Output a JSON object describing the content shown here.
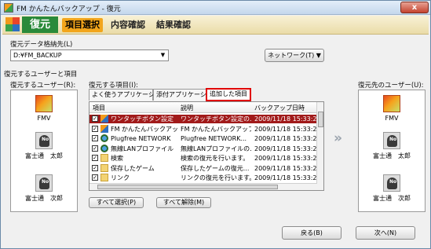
{
  "window": {
    "title": "FM かんたんバックアップ - 復元",
    "close_label": "x"
  },
  "header": {
    "mode": "復元",
    "steps": [
      "項目選択",
      "内容確認",
      "結果確認"
    ],
    "active_step": 0
  },
  "destination": {
    "label": "復元データ格納先(L)",
    "value": "D:¥FM_BACKUP",
    "network_button": "ネットワーク(T) ▼"
  },
  "section_label": "復元するユーザーと項目",
  "source_users": {
    "label": "復元するユーザー(R):",
    "users": [
      {
        "name": "FMV",
        "avatar": "fmv-orange"
      },
      {
        "name": "富士通　太郎",
        "avatar": "no-image"
      },
      {
        "name": "富士通　次郎",
        "avatar": "no-image"
      }
    ]
  },
  "items": {
    "label": "復元する項目(I):",
    "tabs": [
      "よく使うアプリケーション",
      "添付アプリケーション",
      "追加した項目"
    ],
    "selected_tab": 2,
    "columns": [
      "項目",
      "説明",
      "バックアップ日時"
    ],
    "rows": [
      {
        "name": "ワンタッチボタン設定",
        "desc": "ワンタッチボタン設定の...",
        "date": "2009/11/18 15:33:25",
        "checked": true,
        "selected": true,
        "icon": "app-icon"
      },
      {
        "name": "FM かんたんバックアップ",
        "desc": "FM かんたんバックアップ...",
        "date": "2009/11/18 15:33:25",
        "checked": true,
        "selected": false,
        "icon": "app-icon"
      },
      {
        "name": "Plugfree NETWORK",
        "desc": "Plugfree NETWORK...",
        "date": "2009/11/18 15:33:25",
        "checked": true,
        "selected": false,
        "icon": "network-icon"
      },
      {
        "name": "無線LANプロファイル",
        "desc": "無線LANプロファイルの...",
        "date": "2009/11/18 15:33:25",
        "checked": true,
        "selected": false,
        "icon": "network-icon"
      },
      {
        "name": "検索",
        "desc": "検索の復元を行います。",
        "date": "2009/11/18 15:33:25",
        "checked": true,
        "selected": false,
        "icon": "folder-icon"
      },
      {
        "name": "保存したゲーム",
        "desc": "保存したゲームの復元...",
        "date": "2009/11/18 15:33:25",
        "checked": true,
        "selected": false,
        "icon": "folder-icon"
      },
      {
        "name": "リンク",
        "desc": "リンクの復元を行います。",
        "date": "2009/11/18 15:33:25",
        "checked": true,
        "selected": false,
        "icon": "folder-icon"
      }
    ],
    "select_all": "すべて選択(P)",
    "deselect_all": "すべて解除(M)"
  },
  "dest_users": {
    "label": "復元先のユーザー(U):",
    "users": [
      {
        "name": "FMV",
        "avatar": "fmv-orange"
      },
      {
        "name": "富士通　太郎",
        "avatar": "no-image"
      },
      {
        "name": "富士通　次郎",
        "avatar": "no-image"
      }
    ]
  },
  "footer": {
    "back": "戻る(B)",
    "next": "次へ(N)"
  },
  "colors": {
    "accent": "#f2a51b",
    "mode_green": "#2a8a3a",
    "selection": "#a11a1a",
    "highlight_border": "#e00000"
  }
}
